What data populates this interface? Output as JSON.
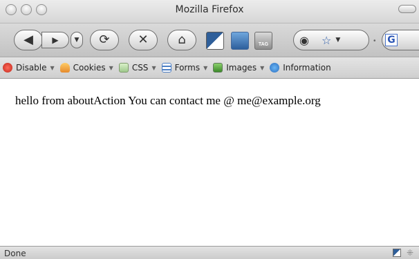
{
  "window": {
    "title": "Mozilla Firefox"
  },
  "navbar": {
    "buttons": [
      "back",
      "forward",
      "reload",
      "stop",
      "home"
    ],
    "bookmark_icon_text": "TAG",
    "search_engine_letter": "G"
  },
  "bookmarks_bar": {
    "items": [
      {
        "label": "Disable",
        "icon": "disable-icon"
      },
      {
        "label": "Cookies",
        "icon": "cookies-icon"
      },
      {
        "label": "CSS",
        "icon": "css-icon"
      },
      {
        "label": "Forms",
        "icon": "forms-icon"
      },
      {
        "label": "Images",
        "icon": "images-icon"
      },
      {
        "label": "Information",
        "icon": "information-icon"
      }
    ]
  },
  "page": {
    "text": "hello from aboutAction You can contact me @ me@example.org"
  },
  "status": {
    "text": "Done"
  }
}
